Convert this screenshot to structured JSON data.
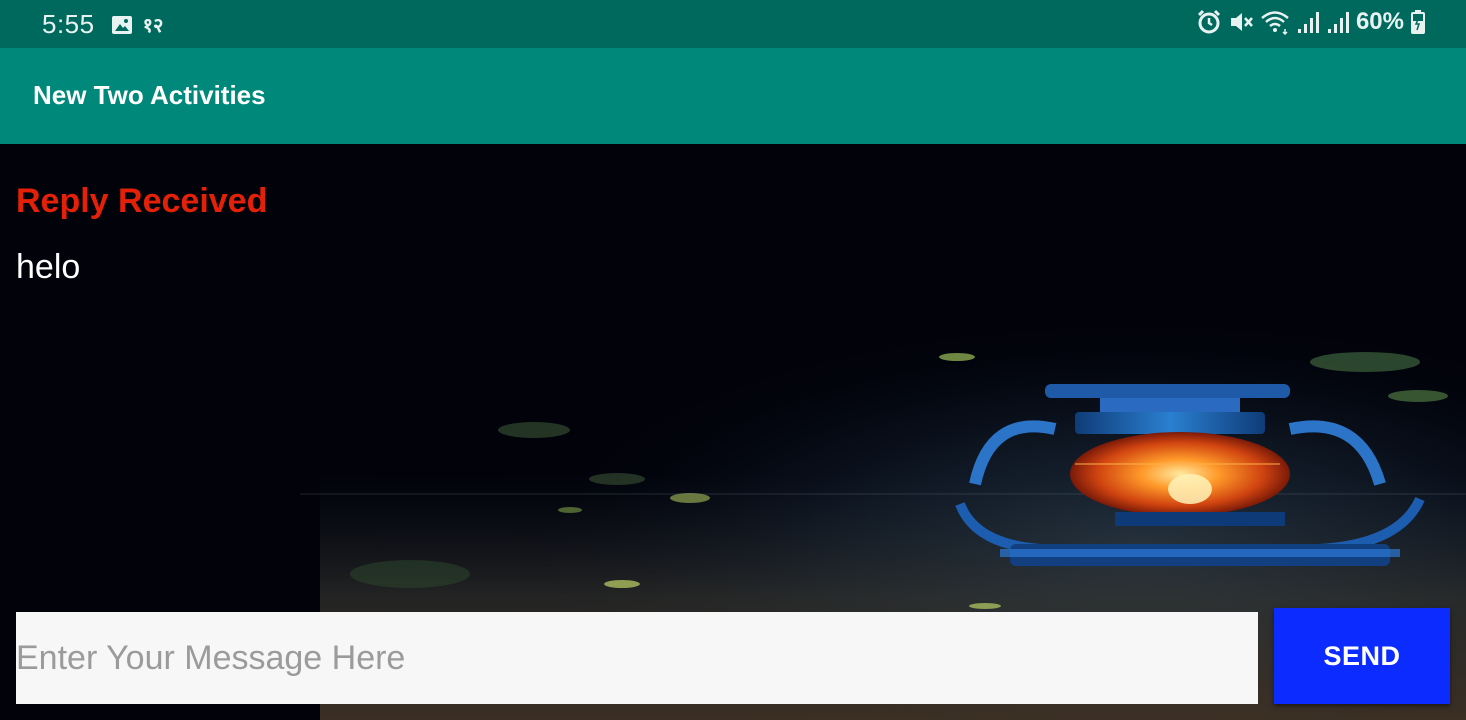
{
  "status_bar": {
    "time": "5:55",
    "extra": "१२",
    "battery": "60%",
    "icons": [
      "gallery-icon",
      "alarm-icon",
      "mute-icon",
      "wifi-icon",
      "signal-icon",
      "signal-icon",
      "battery-icon"
    ]
  },
  "app_bar": {
    "title": "New Two Activities"
  },
  "reply": {
    "heading": "Reply Received",
    "message": "helo"
  },
  "composer": {
    "placeholder": "Enter Your Message Here",
    "value": "",
    "send_label": "SEND"
  },
  "colors": {
    "status_bar": "#00695e",
    "app_bar": "#00897b",
    "reply_heading": "#e52008",
    "send_button": "#0c2cff"
  }
}
